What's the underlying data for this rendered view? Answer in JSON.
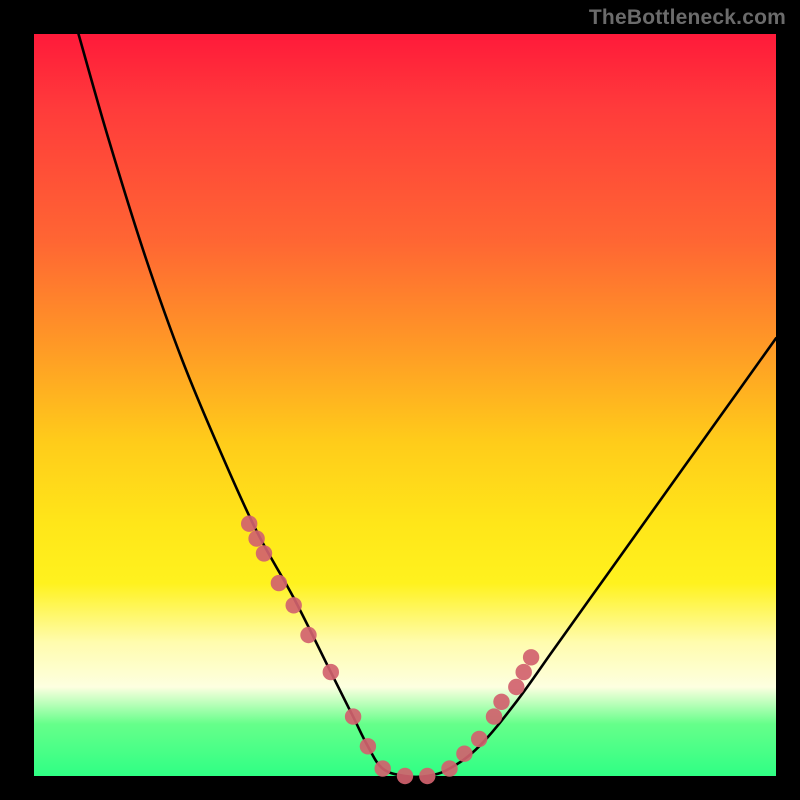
{
  "watermark": "TheBottleneck.com",
  "chart_data": {
    "type": "line",
    "title": "",
    "xlabel": "",
    "ylabel": "",
    "xlim": [
      0,
      100
    ],
    "ylim": [
      0,
      100
    ],
    "series": [
      {
        "name": "bottleneck-curve",
        "x": [
          6,
          10,
          15,
          20,
          25,
          30,
          35,
          40,
          43,
          45,
          47,
          50,
          53,
          56,
          60,
          65,
          70,
          75,
          80,
          85,
          90,
          95,
          100
        ],
        "values": [
          100,
          86,
          70,
          56,
          44,
          33,
          24,
          14,
          8,
          4,
          1,
          0,
          0,
          1,
          4,
          10,
          17,
          24,
          31,
          38,
          45,
          52,
          59
        ]
      }
    ],
    "markers": {
      "name": "data-points",
      "color": "#d1626e",
      "x": [
        29,
        30,
        31,
        33,
        35,
        37,
        40,
        43,
        45,
        47,
        50,
        53,
        56,
        58,
        60,
        62,
        63,
        65,
        66,
        67
      ],
      "values": [
        34,
        32,
        30,
        26,
        23,
        19,
        14,
        8,
        4,
        1,
        0,
        0,
        1,
        3,
        5,
        8,
        10,
        12,
        14,
        16
      ]
    }
  }
}
